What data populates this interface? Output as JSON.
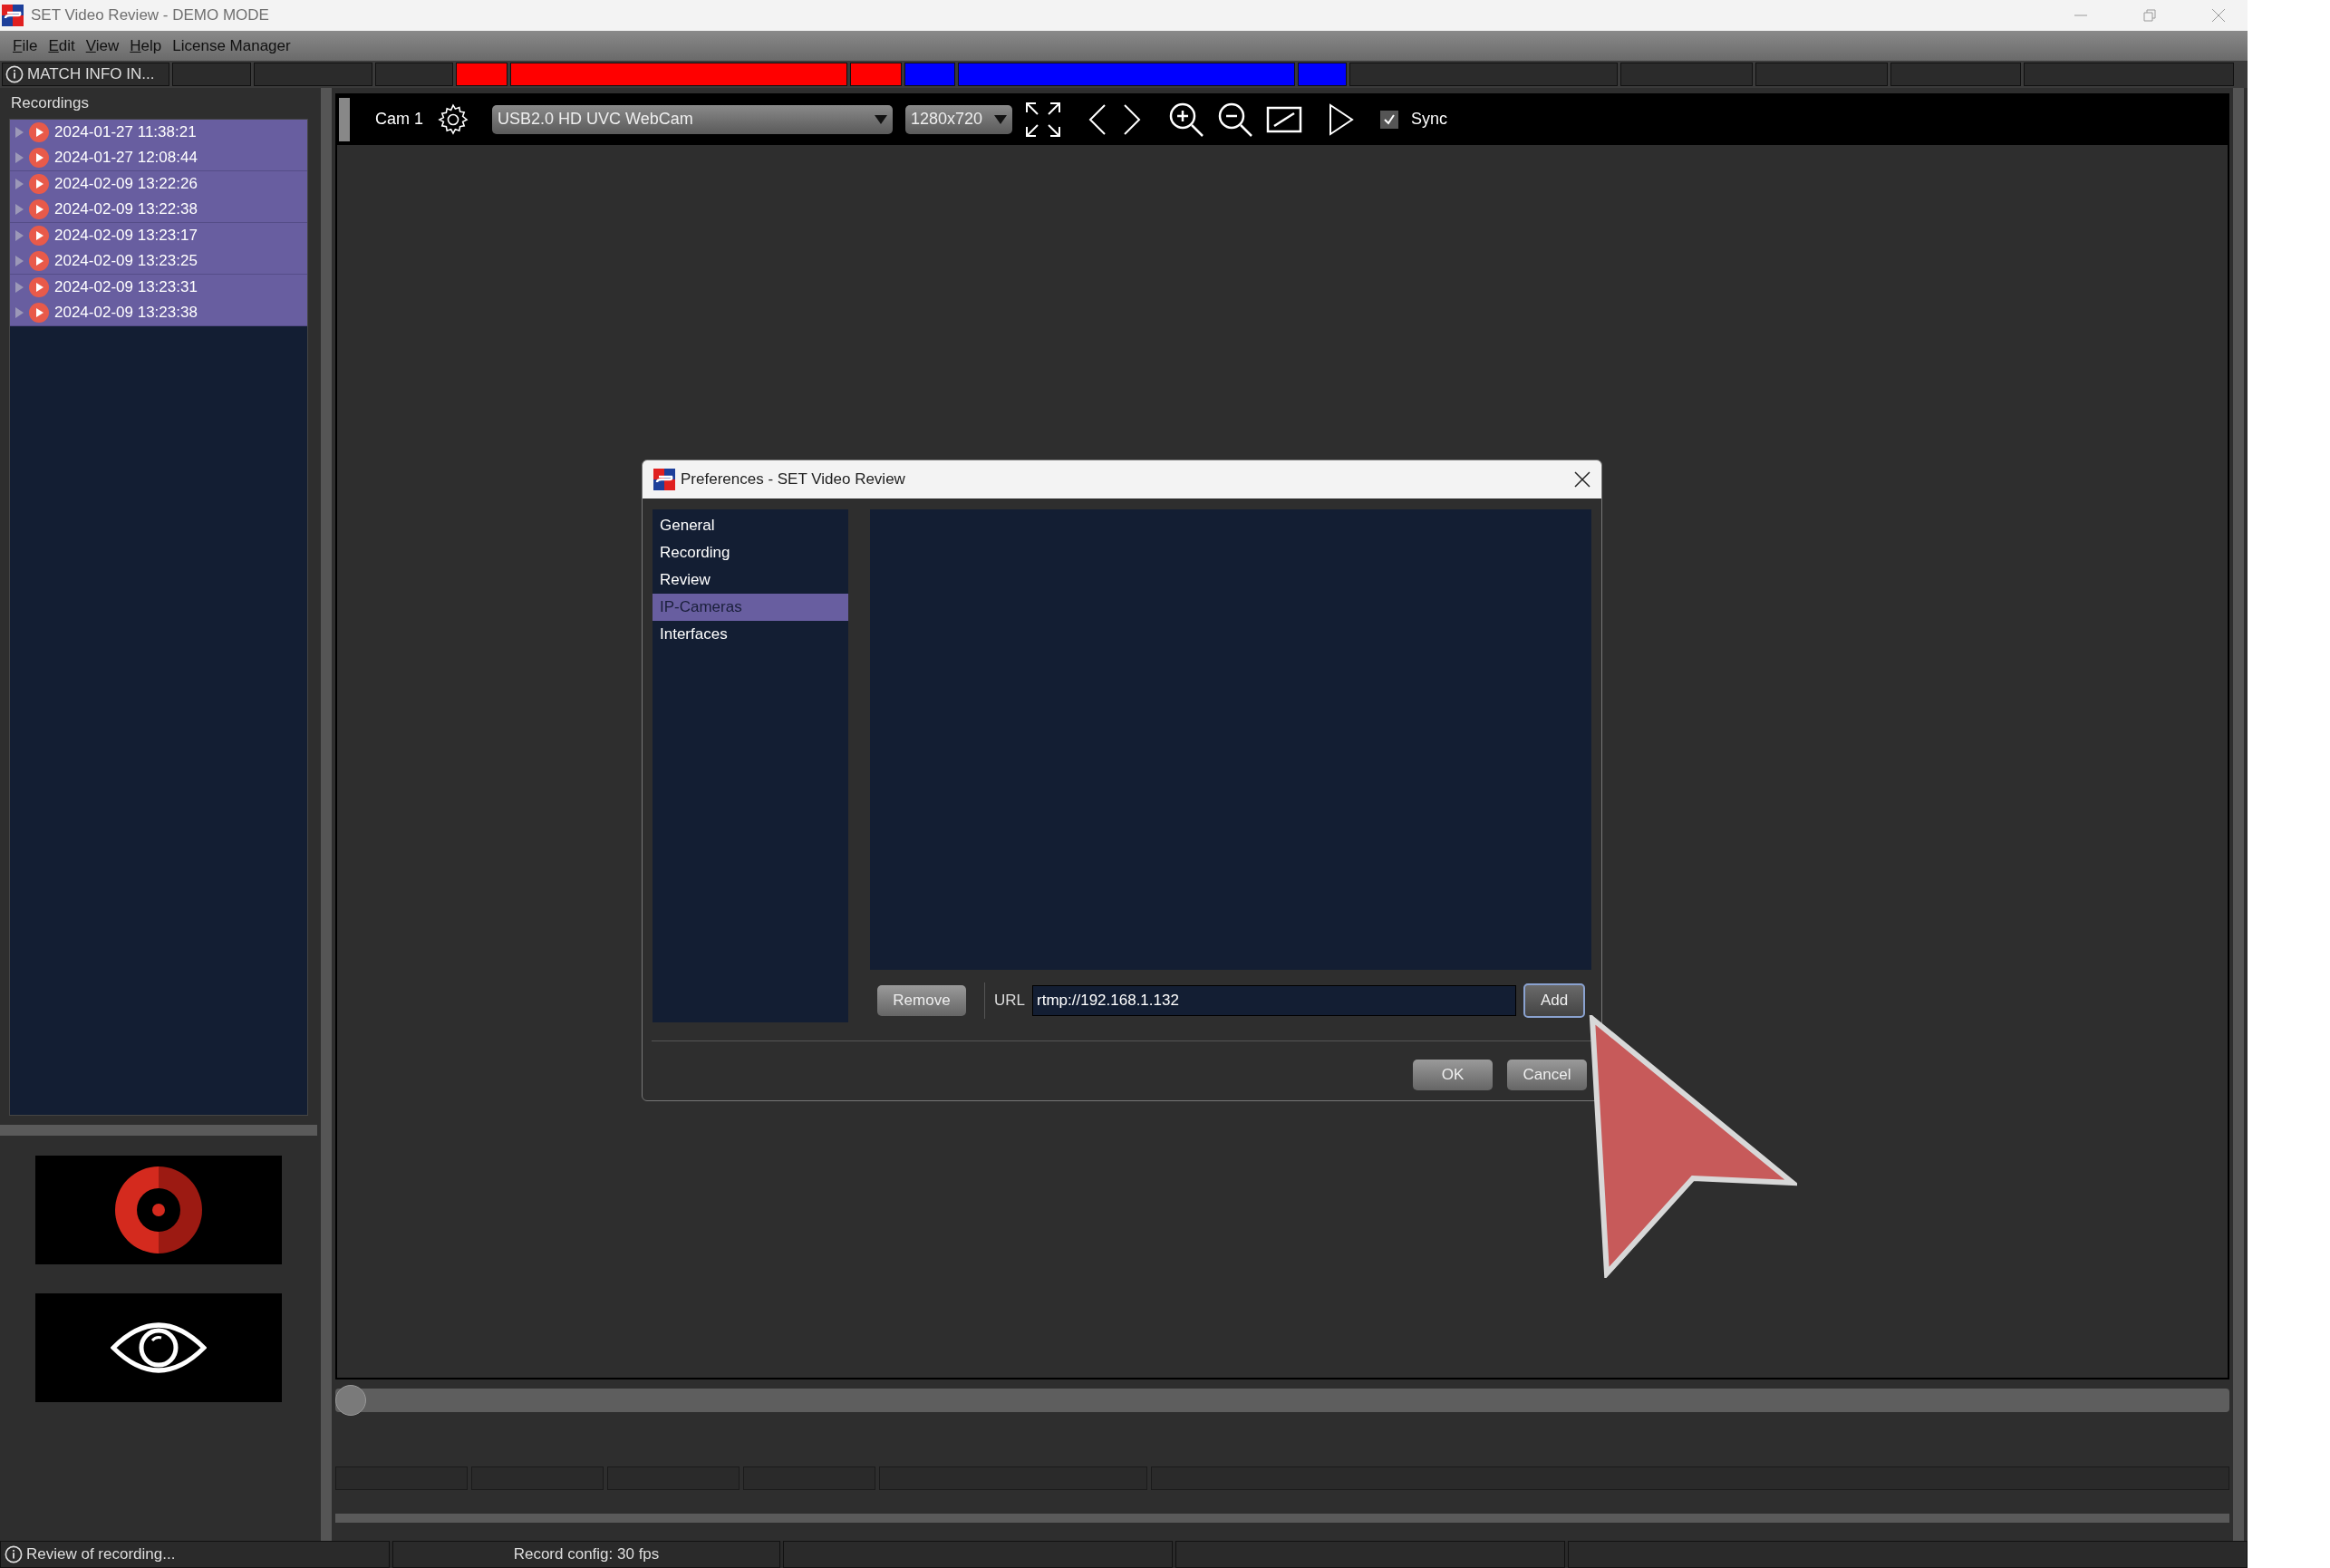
{
  "window": {
    "title": "SET Video Review - DEMO MODE"
  },
  "menu": [
    {
      "label": "File",
      "underline_first": true
    },
    {
      "label": "Edit",
      "underline_first": true
    },
    {
      "label": "View",
      "underline_first": true
    },
    {
      "label": "Help",
      "underline_first": true
    },
    {
      "label": "License Manager",
      "underline_first": false
    }
  ],
  "info_bar": {
    "label": "MATCH INFO IN...",
    "segments": [
      {
        "color": "#2b2b2b"
      },
      {
        "color": "#2b2b2b"
      },
      {
        "color": "#2b2b2b"
      },
      {
        "color": "#ff0000"
      },
      {
        "color": "#ff0000"
      },
      {
        "color": "#ff0000"
      },
      {
        "color": "#0000ff"
      },
      {
        "color": "#0000ff"
      },
      {
        "color": "#0000ff"
      },
      {
        "color": "#2b2b2b"
      },
      {
        "color": "#2b2b2b"
      },
      {
        "color": "#2b2b2b"
      },
      {
        "color": "#2b2b2b"
      },
      {
        "color": "#2b2b2b"
      }
    ]
  },
  "recordings": {
    "title": "Recordings",
    "items": [
      {
        "label": "2024-01-27 11:38:21",
        "selected": true
      },
      {
        "label": "2024-01-27 12:08:44",
        "selected": true
      },
      {
        "label": "2024-02-09 13:22:26",
        "selected": true
      },
      {
        "label": "2024-02-09 13:22:38",
        "selected": true
      },
      {
        "label": "2024-02-09 13:23:17",
        "selected": true
      },
      {
        "label": "2024-02-09 13:23:25",
        "selected": true
      },
      {
        "label": "2024-02-09 13:23:31",
        "selected": true
      },
      {
        "label": "2024-02-09 13:23:38",
        "selected": true
      }
    ]
  },
  "camera": {
    "label": "Cam 1",
    "source": "USB2.0 HD UVC WebCam",
    "resolution": "1280x720",
    "sync": {
      "label": "Sync",
      "checked": true
    }
  },
  "timeline": {
    "level": 0
  },
  "dialog": {
    "title": "Preferences - SET Video Review",
    "categories": [
      {
        "label": "General",
        "selected": false
      },
      {
        "label": "Recording",
        "selected": false
      },
      {
        "label": "Review",
        "selected": false
      },
      {
        "label": "IP-Cameras",
        "selected": true
      },
      {
        "label": "Interfaces",
        "selected": false
      }
    ],
    "remove": "Remove",
    "url_label": "URL",
    "url_value": "rtmp://192.168.1.132",
    "add": "Add",
    "ok": "OK",
    "cancel": "Cancel"
  },
  "status_bar": {
    "message": "Review of recording...",
    "record_config": "Record config: 30 fps"
  }
}
